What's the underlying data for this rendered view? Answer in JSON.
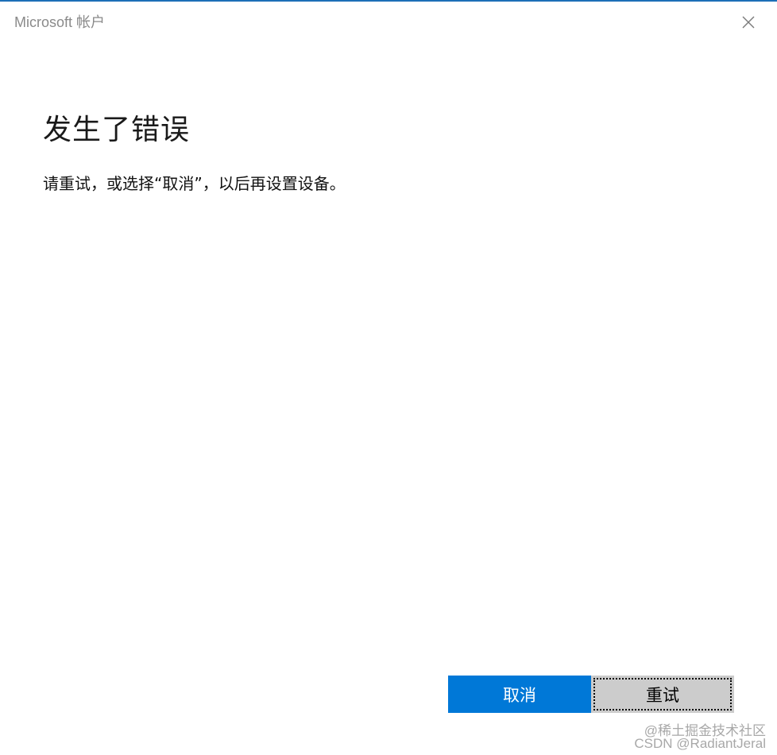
{
  "window": {
    "title": "Microsoft 帐户"
  },
  "dialog": {
    "headline": "发生了错误",
    "message": "请重试，或选择“取消”，以后再设置设备。"
  },
  "buttons": {
    "cancel_label": "取消",
    "retry_label": "重试"
  },
  "watermark": {
    "line1": "@稀土掘金技术社区",
    "line2": "CSDN @RadiantJeral"
  },
  "icons": {
    "close": "close-icon"
  },
  "colors": {
    "accent": "#0078d7",
    "secondary_button": "#cccccc",
    "title_text": "#8a8a8a",
    "top_border": "#1c6fb7"
  }
}
